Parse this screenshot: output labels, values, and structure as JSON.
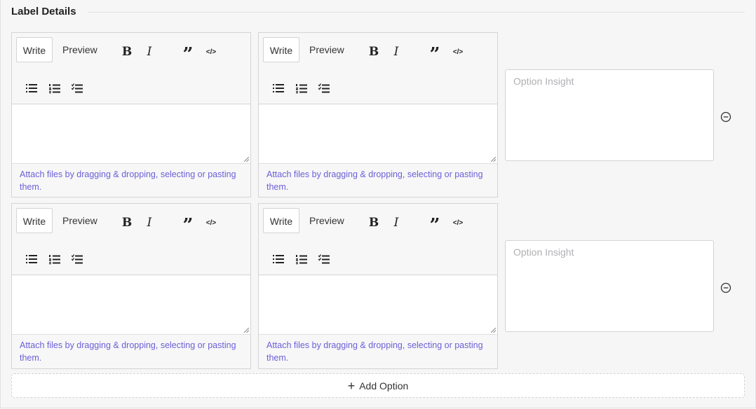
{
  "section": {
    "title": "Label Details"
  },
  "editor": {
    "tab_write": "Write",
    "tab_preview": "Preview",
    "bold_glyph": "B",
    "italic_glyph": "I",
    "quote_glyph": "”",
    "code_glyph": "</>",
    "attach_note": "Attach files by dragging & dropping, selecting or pasting them."
  },
  "options": [
    {
      "insight_placeholder": "Option Insight"
    },
    {
      "insight_placeholder": "Option Insight"
    }
  ],
  "add_option": {
    "plus": "+",
    "label": "Add Option"
  },
  "icons": {
    "bold": "bold-icon",
    "italic": "italic-icon",
    "quote": "quote-icon",
    "code": "code-icon",
    "unordered_list": "unordered-list-icon",
    "ordered_list": "ordered-list-icon",
    "task_list": "task-list-icon",
    "remove": "minus-circle-icon",
    "add": "plus-icon"
  },
  "colors": {
    "link": "#6b5fd6",
    "border": "#d4d4d7",
    "background": "#f6f6f7"
  }
}
